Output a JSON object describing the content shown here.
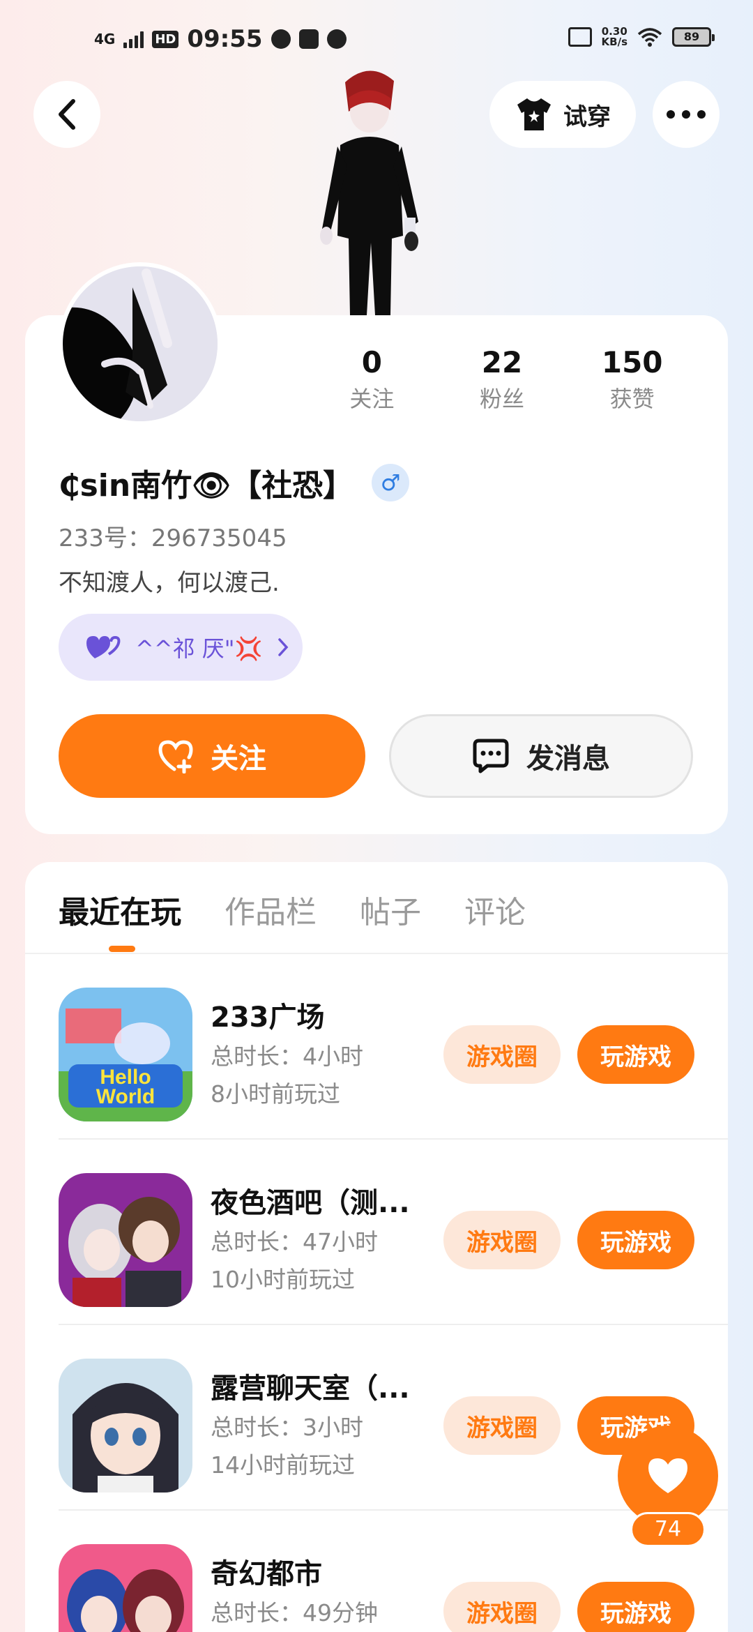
{
  "status_bar": {
    "network": "4G",
    "hd_badge": "HD",
    "time": "09:55",
    "speed_value": "0.30",
    "speed_unit": "KB/s",
    "battery": "89"
  },
  "header": {
    "try_on_label": "试穿"
  },
  "profile": {
    "stats": [
      {
        "value": "0",
        "label": "关注"
      },
      {
        "value": "22",
        "label": "粉丝"
      },
      {
        "value": "150",
        "label": "获赞"
      }
    ],
    "nickname": "₵sin南竹👁【社恐】",
    "gender_symbol": "♂",
    "uid": "233号：296735045",
    "bio": "不知渡人，何以渡己.",
    "tag_label": "^^祁 厌\"💢",
    "follow_label": "关注",
    "message_label": "发消息"
  },
  "tabs": [
    "最近在玩",
    "作品栏",
    "帖子",
    "评论"
  ],
  "games": [
    {
      "name": "233广场",
      "time": "总时长：4小时",
      "last": "8小时前玩过",
      "circle": "游戏圈",
      "play": "玩游戏"
    },
    {
      "name": "夜色酒吧（测...",
      "time": "总时长：47小时",
      "last": "10小时前玩过",
      "circle": "游戏圈",
      "play": "玩游戏"
    },
    {
      "name": "露营聊天室（...",
      "time": "总时长：3小时",
      "last": "14小时前玩过",
      "circle": "游戏圈",
      "play": "玩游戏"
    },
    {
      "name": "奇幻都市",
      "time": "总时长：49分钟",
      "last": "",
      "circle": "游戏圈",
      "play": "玩游戏"
    }
  ],
  "like_fab": {
    "count": "74"
  },
  "colors": {
    "accent": "#ff7a12",
    "accent_light": "#fde7d9",
    "tag_bg": "#e9e6fb",
    "tag_text": "#6a52d8"
  }
}
